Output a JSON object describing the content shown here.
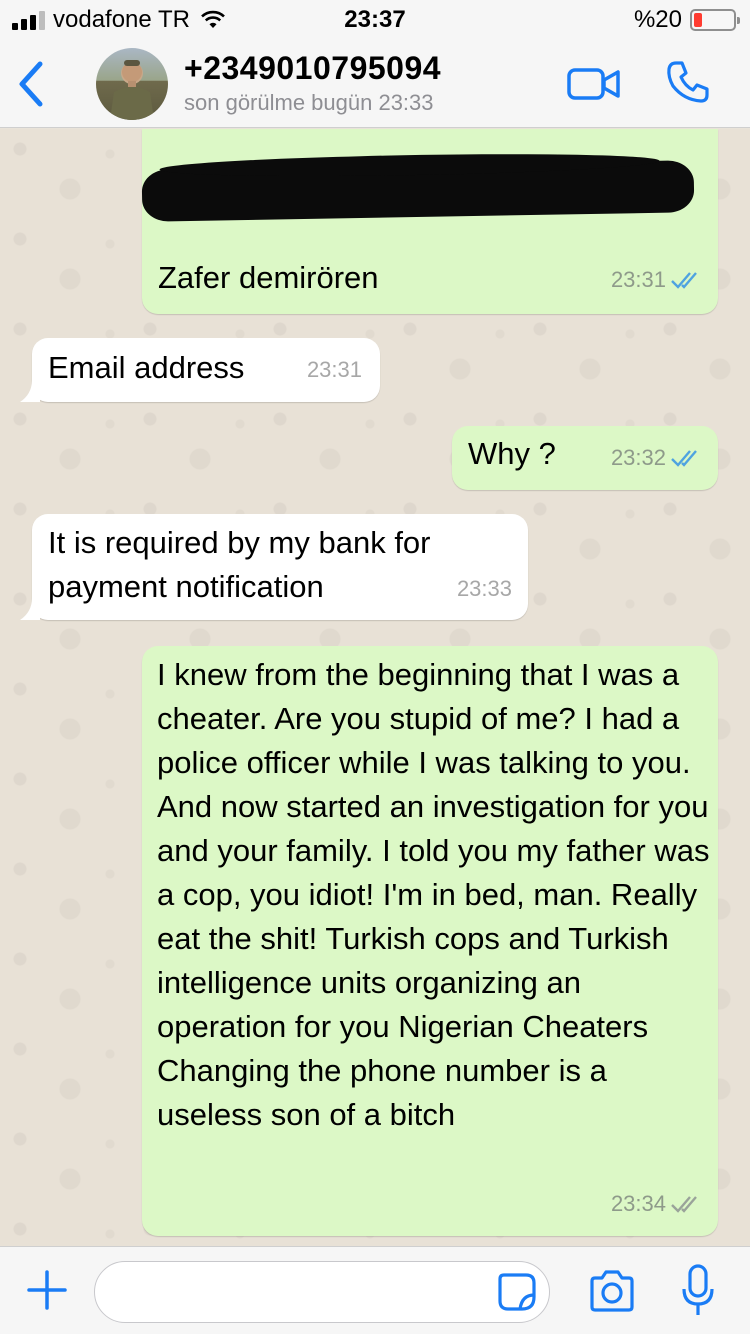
{
  "status_bar": {
    "carrier": "vodafone TR",
    "time": "23:37",
    "battery": "%20",
    "battery_level": 0.2,
    "battery_color": "#ff3b30"
  },
  "header": {
    "contact_name": "+2349010795094",
    "last_seen": "son görülme bugün 23:33",
    "back_icon": "chevron-left-icon",
    "video_icon": "video-camera-icon",
    "call_icon": "phone-icon",
    "accent": "#1a7cf5"
  },
  "messages": [
    {
      "direction": "outgoing",
      "text": "Zafer demirören",
      "redacted_line": true,
      "time": "23:31",
      "status": "read"
    },
    {
      "direction": "incoming",
      "text": "Email address",
      "time": "23:31"
    },
    {
      "direction": "outgoing",
      "text": "Why ?",
      "time": "23:32",
      "status": "read"
    },
    {
      "direction": "incoming",
      "text": "It is required by my bank for payment notification",
      "time": "23:33"
    },
    {
      "direction": "outgoing",
      "text": "I knew from the beginning that I was a cheater. Are you stupid of me? I had a police officer while I was talking to you. And now started an investigation for you and your family. I told you my father was a cop, you idiot! I'm in bed, man. Really eat the shit! Turkish cops and Turkish intelligence units organizing an operation for you Nigerian Cheaters\nChanging the phone number is a useless son of a bitch",
      "time": "23:34",
      "status": "delivered"
    }
  ],
  "colors": {
    "outgoing_bubble": "#dcf8c6",
    "incoming_bubble": "#ffffff",
    "read_ticks": "#4fa3e0",
    "delivered_ticks": "#9aa39a"
  },
  "input_bar": {
    "plus_icon": "plus-icon",
    "sticker_icon": "sticker-icon",
    "camera_icon": "camera-icon",
    "mic_icon": "microphone-icon",
    "message_value": ""
  }
}
